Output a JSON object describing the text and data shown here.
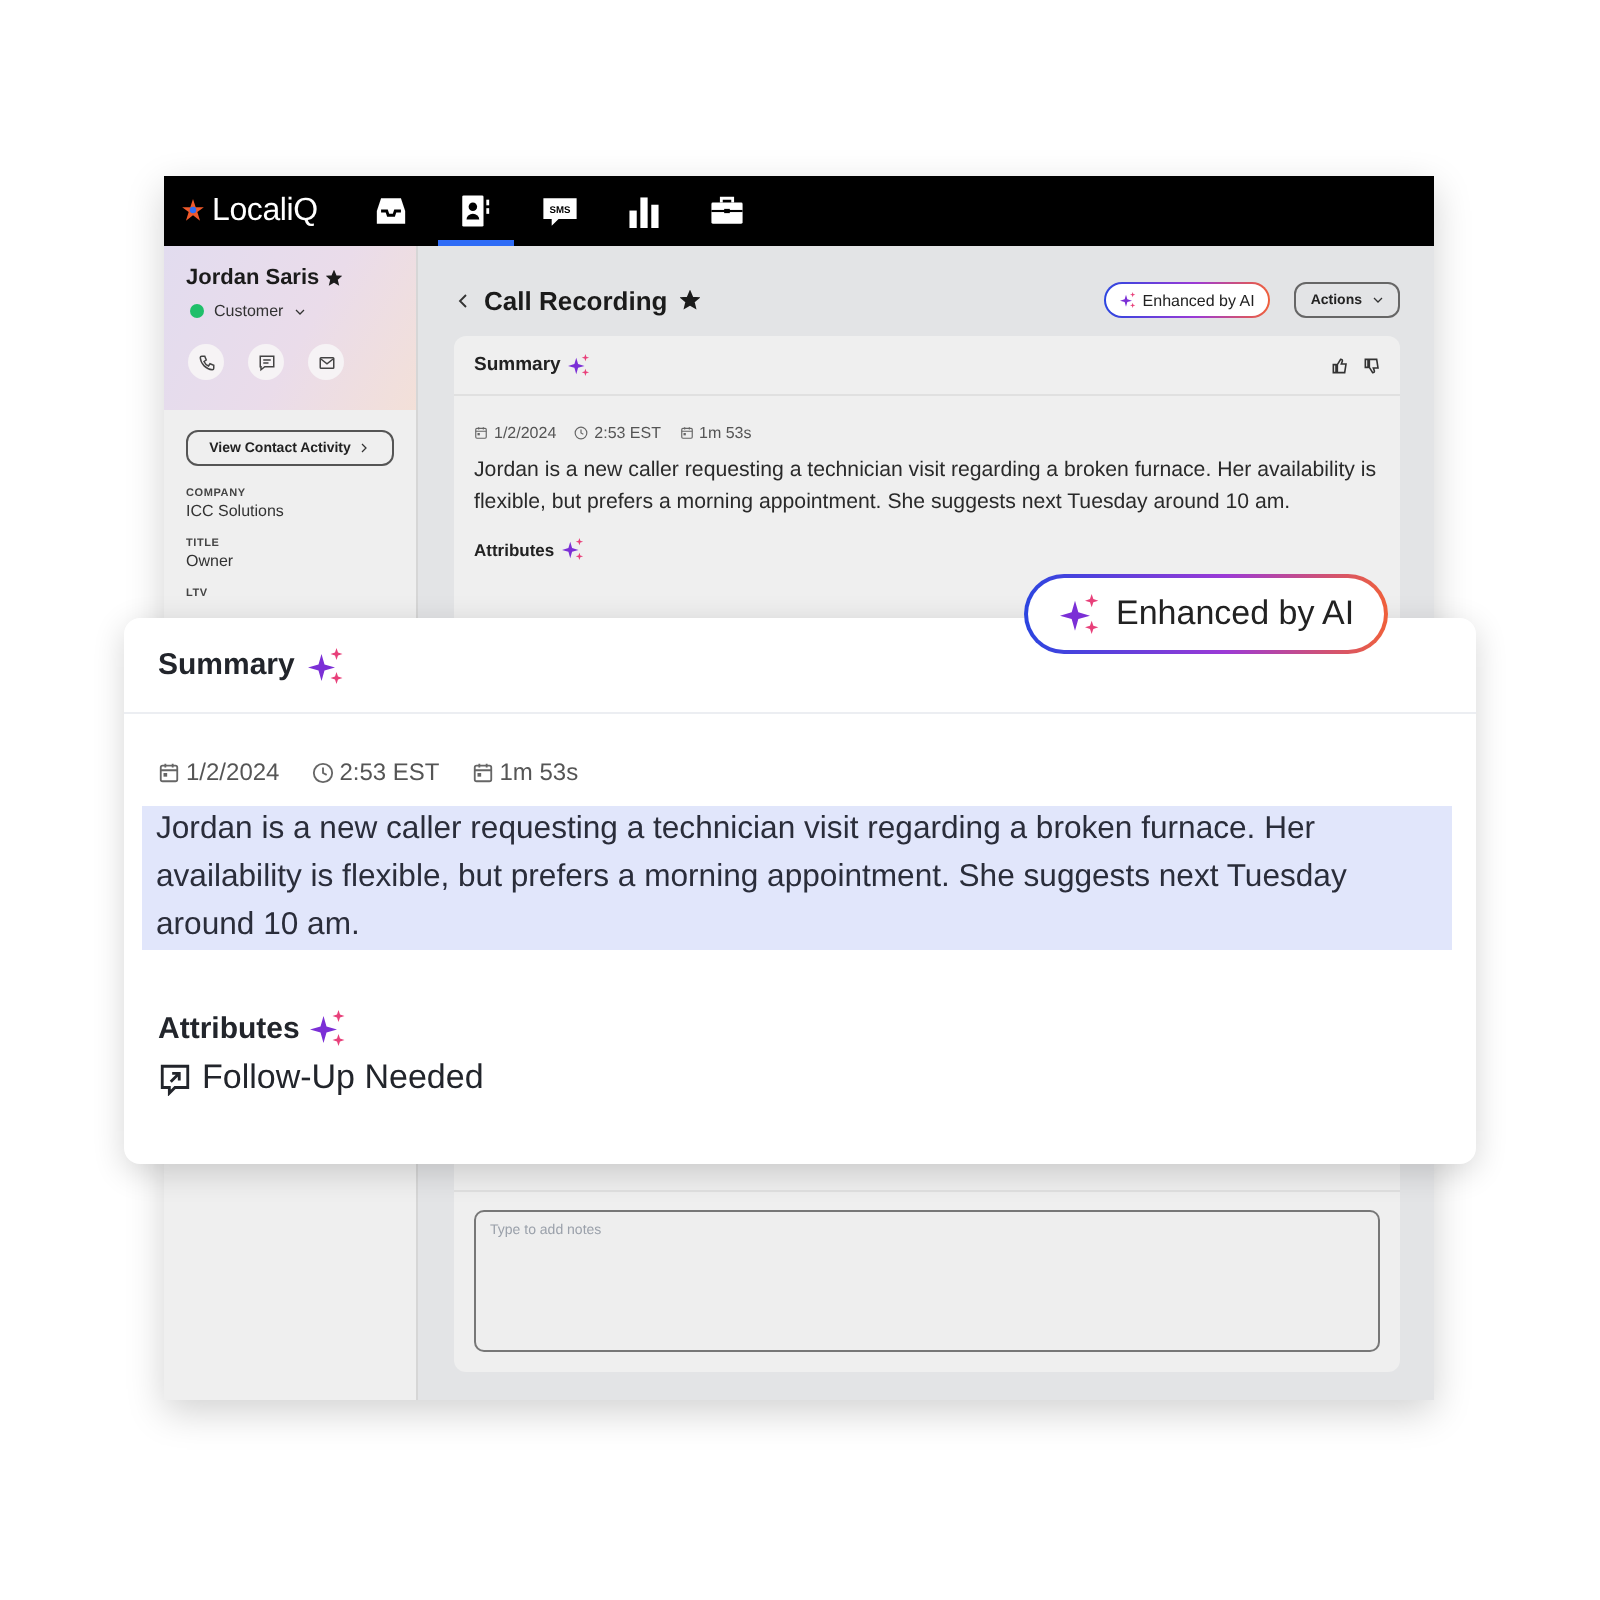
{
  "nav": {
    "logo": "LocaliQ",
    "items": [
      {
        "kind": "inbox",
        "selected": false
      },
      {
        "kind": "contacts",
        "selected": true
      },
      {
        "kind": "sms",
        "text": "SMS",
        "selected": false
      },
      {
        "kind": "reports",
        "selected": false
      },
      {
        "kind": "briefcase",
        "selected": false
      }
    ]
  },
  "contact": {
    "name": "Jordan Saris",
    "starred": true,
    "status": {
      "label": "Customer",
      "color": "#1fbf6a"
    },
    "actions": [
      {
        "kind": "phone"
      },
      {
        "kind": "message"
      },
      {
        "kind": "mail"
      }
    ],
    "activity_button": "View Contact Activity",
    "fields": [
      {
        "label": "COMPANY",
        "value": "ICC Solutions"
      },
      {
        "label": "TITLE",
        "value": "Owner"
      },
      {
        "label": "LTV"
      }
    ]
  },
  "page": {
    "title": "Call Recording",
    "starred": true,
    "ai_badge": "Enhanced by AI",
    "actions_button": "Actions"
  },
  "summary_card": {
    "title": "Summary",
    "date": "1/2/2024",
    "time": "2:53 EST",
    "duration": "1m 53s",
    "text": "Jordan is a new caller requesting a technician visit regarding a broken furnace. Her availability is flexible, but prefers a morning appointment. She suggests next Tuesday around 10 am.",
    "attributes_title": "Attributes"
  },
  "notes": {
    "placeholder": "Type to add notes"
  },
  "overlay": {
    "badge": "Enhanced by AI",
    "title": "Summary",
    "date": "1/2/2024",
    "time": "2:53 EST",
    "duration": "1m 53s",
    "text": "Jordan is a new caller requesting a technician visit regarding a broken furnace. Her availability is flexible, but prefers a morning appointment. She suggests next Tuesday around 10 am.",
    "highlighted": true,
    "attributes_title": "Attributes",
    "attributes": [
      "Follow-Up Needed"
    ]
  }
}
